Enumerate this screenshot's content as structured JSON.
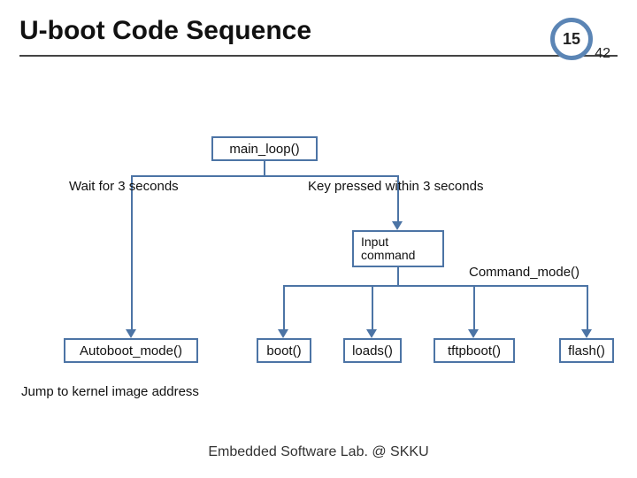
{
  "header": {
    "title": "U-boot Code Sequence",
    "page_number": "15",
    "slide_count": "42"
  },
  "diagram": {
    "main_loop": "main_loop()",
    "wait_label": "Wait for 3 seconds",
    "key_label": "Key pressed within 3 seconds",
    "input_command": "Input command",
    "command_mode": "Command_mode()",
    "autoboot_mode": "Autoboot_mode()",
    "boot": "boot()",
    "loads": "loads()",
    "tftpboot": "tftpboot()",
    "flash": "flash()",
    "jump_label": "Jump to kernel image address"
  },
  "footer": "Embedded Software Lab. @ SKKU"
}
